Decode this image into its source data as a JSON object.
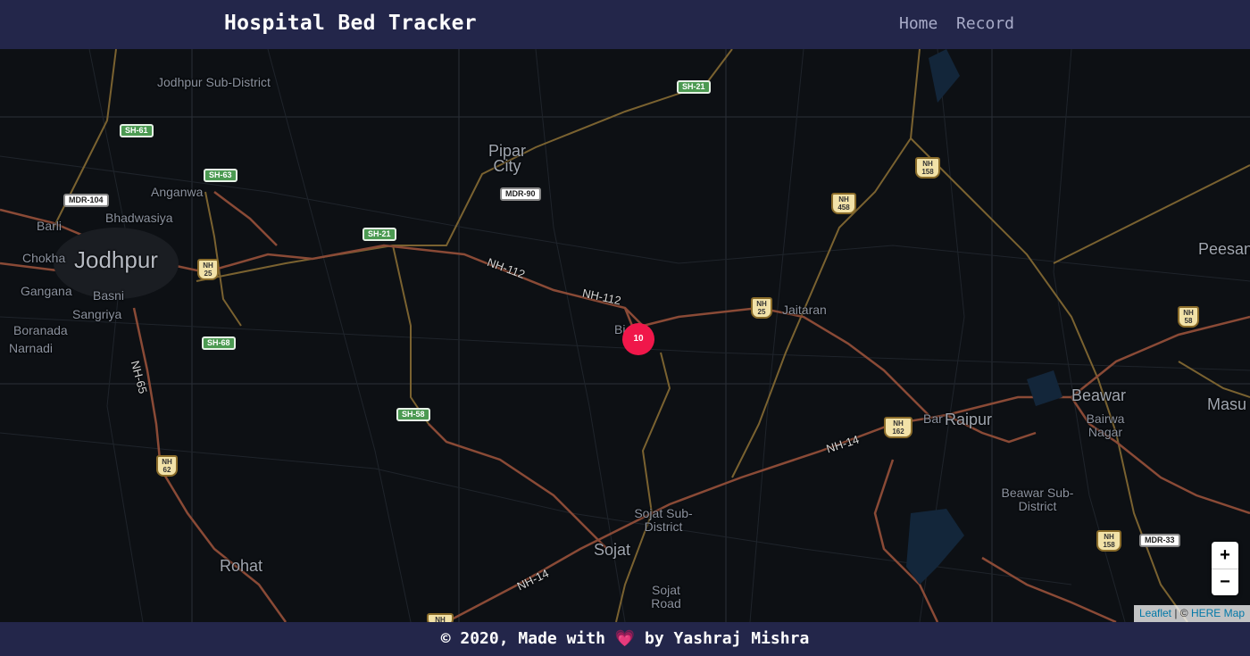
{
  "header": {
    "title": "Hospital Bed Tracker",
    "nav": [
      "Home",
      "Record"
    ]
  },
  "map": {
    "places": [
      {
        "id": "jodhpur",
        "name": "Jodhpur"
      },
      {
        "id": "jodhpur-sub",
        "name": "Jodhpur Sub-District"
      },
      {
        "id": "anganwa",
        "name": "Anganwa"
      },
      {
        "id": "bhadwasiya",
        "name": "Bhadwasiya"
      },
      {
        "id": "barli",
        "name": "Barli"
      },
      {
        "id": "chokha",
        "name": "Chokha"
      },
      {
        "id": "gangana",
        "name": "Gangana"
      },
      {
        "id": "basni",
        "name": "Basni"
      },
      {
        "id": "sangriya",
        "name": "Sangriya"
      },
      {
        "id": "boranada",
        "name": "Boranada"
      },
      {
        "id": "narnadi",
        "name": "Narnadi"
      },
      {
        "id": "pipar",
        "name": "Pipar City"
      },
      {
        "id": "jaitaran",
        "name": "Jaitaran"
      },
      {
        "id": "raipur",
        "name": "Raipur"
      },
      {
        "id": "bar",
        "name": "Bar"
      },
      {
        "id": "beawar",
        "name": "Beawar"
      },
      {
        "id": "bairwa",
        "name": "Bairwa Nagar"
      },
      {
        "id": "beawar-sub",
        "name": "Beawar Sub-District"
      },
      {
        "id": "peesan",
        "name": "Peesan"
      },
      {
        "id": "masuda",
        "name": "Masu"
      },
      {
        "id": "sojat",
        "name": "Sojat"
      },
      {
        "id": "sojat-sub",
        "name": "Sojat Sub-District"
      },
      {
        "id": "sojat-road",
        "name": "Sojat Road"
      },
      {
        "id": "rohat",
        "name": "Rohat"
      },
      {
        "id": "bilara",
        "name": "Bi"
      }
    ],
    "shields": [
      {
        "type": "sh",
        "label": "SH-21"
      },
      {
        "type": "sh",
        "label": "SH-61"
      },
      {
        "type": "sh",
        "label": "SH-63"
      },
      {
        "type": "sh",
        "label": "SH-21"
      },
      {
        "type": "sh",
        "label": "SH-68"
      },
      {
        "type": "sh",
        "label": "SH-58"
      },
      {
        "type": "mdr",
        "label": "MDR-104"
      },
      {
        "type": "mdr",
        "label": "MDR-90"
      },
      {
        "type": "mdr",
        "label": "MDR-33"
      },
      {
        "type": "nh",
        "label": "NH 158"
      },
      {
        "type": "nh",
        "label": "NH 458"
      },
      {
        "type": "nh",
        "label": "NH 25"
      },
      {
        "type": "nh",
        "label": "NH 25"
      },
      {
        "type": "nh",
        "label": "NH 58"
      },
      {
        "type": "nh",
        "label": "NH 162"
      },
      {
        "type": "nh",
        "label": "NH 62"
      },
      {
        "type": "nh",
        "label": "NH 158"
      },
      {
        "type": "nh",
        "label": "NH"
      }
    ],
    "highways": [
      "NH-112",
      "NH-112",
      "NH-65",
      "NH-14",
      "NH-14"
    ],
    "marker": {
      "count": "10",
      "color": "#f0174a"
    },
    "zoom_in": "+",
    "zoom_out": "−",
    "attribution": {
      "leaflet": "Leaflet",
      "sep": " | © ",
      "provider": "HERE Map"
    }
  },
  "footer": {
    "prefix": "© 2020, Made with",
    "heart": "💗",
    "suffix": "by Yashraj Mishra"
  },
  "colors": {
    "navbar": "#23264a",
    "map_bg": "#0d1014",
    "marker": "#f0174a",
    "road_major": "#8a4a36",
    "road_minor": "#7a6230"
  }
}
